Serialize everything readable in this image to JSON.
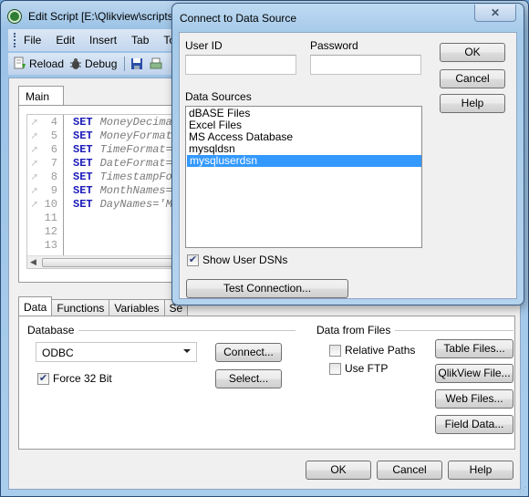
{
  "main_window": {
    "title": "Edit Script [E:\\Qlikview\\scripts",
    "menu": [
      "File",
      "Edit",
      "Insert",
      "Tab",
      "To"
    ],
    "toolbar": {
      "reload_label": "Reload",
      "debug_label": "Debug"
    },
    "script_tab": "Main",
    "code_lines": [
      {
        "num": "4",
        "keyword": "SET",
        "text": "MoneyDecimal"
      },
      {
        "num": "5",
        "keyword": "SET",
        "text": "MoneyFormat="
      },
      {
        "num": "6",
        "keyword": "SET",
        "text": "TimeFormat='"
      },
      {
        "num": "7",
        "keyword": "SET",
        "text": "DateFormat='"
      },
      {
        "num": "8",
        "keyword": "SET",
        "text": "TimestampFor"
      },
      {
        "num": "9",
        "keyword": "SET",
        "text": "MonthNames='"
      },
      {
        "num": "10",
        "keyword": "SET",
        "text": "DayNames='Mo"
      },
      {
        "num": "11",
        "keyword": "",
        "text": ""
      },
      {
        "num": "12",
        "keyword": "",
        "text": ""
      },
      {
        "num": "13",
        "keyword": "",
        "text": ""
      }
    ],
    "bottom_tabs": [
      "Data",
      "Functions",
      "Variables",
      "Se"
    ],
    "active_bottom_tab": "Data",
    "database": {
      "group_label": "Database",
      "selected": "ODBC",
      "force32_label": "Force 32 Bit",
      "force32_checked": true,
      "connect_label": "Connect...",
      "select_label": "Select..."
    },
    "files": {
      "group_label": "Data from Files",
      "relative_paths_label": "Relative Paths",
      "relative_paths_checked": false,
      "use_ftp_label": "Use FTP",
      "use_ftp_checked": false,
      "table_files_label": "Table Files...",
      "qlikview_file_label": "QlikView File...",
      "web_files_label": "Web Files...",
      "field_data_label": "Field Data..."
    },
    "footer": {
      "ok_label": "OK",
      "cancel_label": "Cancel",
      "help_label": "Help"
    }
  },
  "dialog": {
    "title": "Connect to Data Source",
    "close_glyph": "✕",
    "user_id_label": "User ID",
    "user_id_value": "",
    "password_label": "Password",
    "password_value": "",
    "data_sources_label": "Data Sources",
    "data_sources": [
      "dBASE Files",
      "Excel Files",
      "MS Access Database",
      "mysqldsn",
      "mysqluserdsn"
    ],
    "selected_source": "mysqluserdsn",
    "show_user_dsns_label": "Show User DSNs",
    "show_user_dsns_checked": true,
    "test_connection_label": "Test Connection...",
    "ok_label": "OK",
    "cancel_label": "Cancel",
    "help_label": "Help"
  },
  "colors": {
    "selection": "#3399ff",
    "keyword": "#1a1ab8"
  }
}
